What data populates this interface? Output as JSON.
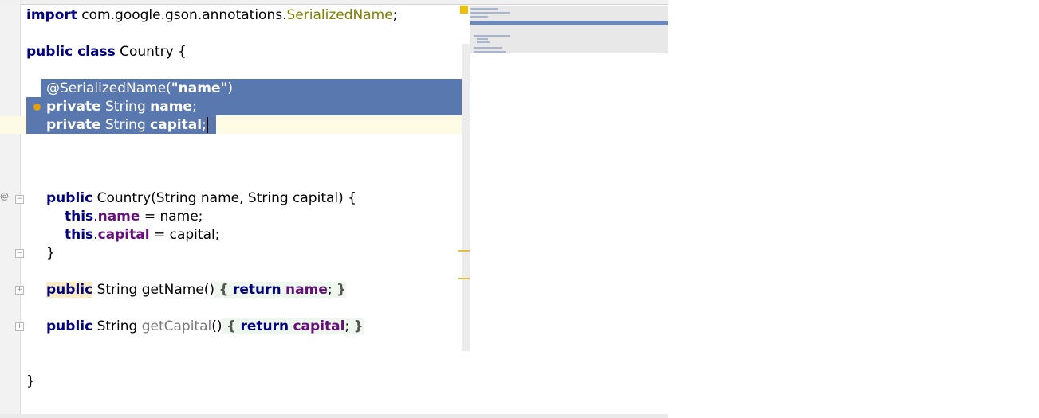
{
  "colors": {
    "keyword": "#000080",
    "annotation": "#808000",
    "string": "#008000",
    "field": "#660e7a",
    "selection": "#5a78b0",
    "caret_line": "#fdfbe3"
  },
  "gutter": {
    "at_marker": "@"
  },
  "code": {
    "l1_kw": "import",
    "l1_pkg": " com.google.gson.annotations.",
    "l1_ann": "SerializedName",
    "l1_end": ";",
    "l2_kw": "public class",
    "l2_rest": " Country {",
    "l3_ann": "@SerializedName(",
    "l3_str": "\"name\"",
    "l3_end": ")",
    "l4_kw": "private",
    "l4_type": " String ",
    "l4_name": "name",
    "l4_end": ";",
    "l5_kw": "private",
    "l5_type": " String ",
    "l5_name": "capital",
    "l5_end": ";",
    "ctor_kw": "public",
    "ctor_rest": " Country(String name, String capital) {",
    "ctor_b1_this": "this",
    "ctor_b1_dot": ".",
    "ctor_b1_field": "name",
    "ctor_b1_rest": " = name;",
    "ctor_b2_this": "this",
    "ctor_b2_dot": ".",
    "ctor_b2_field": "capital",
    "ctor_b2_rest": " = capital;",
    "ctor_close": "}",
    "gn_kw": "public",
    "gn_rest": " String getName()",
    "gn_open": "{",
    "gn_return": "return",
    "gn_field": "name",
    "gn_semi": ";",
    "gn_close": "}",
    "gc_kw": "public",
    "gc_type": " String ",
    "gc_name": "getCapital",
    "gc_paren": "()",
    "gc_open": "{",
    "gc_return": "return",
    "gc_field": "capital",
    "gc_semi": ";",
    "gc_close": "}",
    "class_close": "}"
  }
}
